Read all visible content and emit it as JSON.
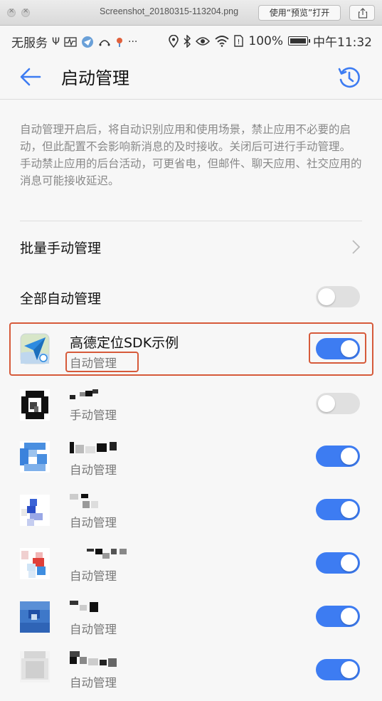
{
  "window": {
    "title": "Screenshot_20180315-113204.png",
    "open_with_label": "使用“预览”打开"
  },
  "statusbar": {
    "carrier": "无服务",
    "battery_percent": "100%",
    "time": "中午11:32"
  },
  "header": {
    "title": "启动管理"
  },
  "description": {
    "para1": "自动管理开启后，将自动识别应用和使用场景，禁止应用不必要的启动，但此配置不会影响新消息的及时接收。关闭后可进行手动管理。",
    "para2": "手动禁止应用的后台活动，可更省电，但邮件、聊天应用、社交应用的消息可能接收延迟。"
  },
  "batch_manual": {
    "label": "批量手动管理"
  },
  "all_auto": {
    "label": "全部自动管理",
    "enabled": false
  },
  "apps": [
    {
      "name": "高德定位SDK示例",
      "status": "自动管理",
      "enabled": true,
      "highlighted": true,
      "icon": "paper-plane-icon"
    },
    {
      "name": "",
      "status": "手动管理",
      "enabled": false,
      "icon": "pixelated-app-icon"
    },
    {
      "name": "",
      "status": "自动管理",
      "enabled": true,
      "icon": "pixelated-app-icon"
    },
    {
      "name": "",
      "status": "自动管理",
      "enabled": true,
      "icon": "pixelated-app-icon"
    },
    {
      "name": "",
      "status": "自动管理",
      "enabled": true,
      "icon": "pixelated-app-icon"
    },
    {
      "name": "",
      "status": "自动管理",
      "enabled": true,
      "icon": "pixelated-app-icon"
    },
    {
      "name": "",
      "status": "自动管理",
      "enabled": true,
      "icon": "pixelated-app-icon"
    }
  ],
  "colors": {
    "accent": "#3d7cf2",
    "highlight": "#d65a3a"
  }
}
